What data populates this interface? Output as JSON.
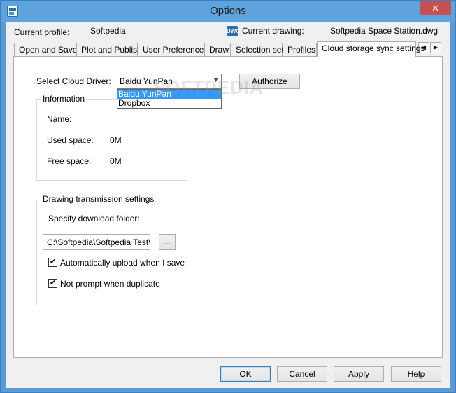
{
  "window": {
    "title": "Options",
    "close_glyph": "✕",
    "app_icon": "app-icon"
  },
  "header": {
    "profile_label": "Current profile:",
    "profile_value": "Softpedia",
    "drawing_label": "Current drawing:",
    "drawing_value": "Softpedia Space Station.dwg",
    "drawing_icon_text": "DWG"
  },
  "tabs": [
    {
      "label": "Open and Save"
    },
    {
      "label": "Plot and Publish"
    },
    {
      "label": "User Preferences"
    },
    {
      "label": "Draw"
    },
    {
      "label": "Selection set"
    },
    {
      "label": "Profiles"
    },
    {
      "label": "Cloud storage sync settings"
    }
  ],
  "tab_scroll": {
    "left": "◀",
    "right": "▶"
  },
  "cloud": {
    "driver_label": "Select Cloud Driver:",
    "driver_selected": "Baidu YunPan",
    "driver_options": [
      "Baidu YunPan",
      "Dropbox"
    ],
    "authorize_button": "Authorize"
  },
  "information": {
    "title": "Information",
    "name_label": "Name:",
    "used_label": "Used space:",
    "used_value": "0M",
    "free_label": "Free space:",
    "free_value": "0M"
  },
  "transmission": {
    "title": "Drawing transmission settings",
    "folder_label": "Specify download folder:",
    "folder_value": "C:\\Softpedia\\Softpedia Test\\A",
    "browse_button": "...",
    "auto_upload_label": "Automatically upload when I save",
    "auto_upload_checked": true,
    "no_prompt_label": "Not prompt when duplicate",
    "no_prompt_checked": true
  },
  "footer": {
    "ok": "OK",
    "cancel": "Cancel",
    "apply": "Apply",
    "help": "Help"
  },
  "watermark": "SOFTPEDIA",
  "colors": {
    "titlebar": "#5fa3de",
    "selection": "#3399ff",
    "close": "#c75050"
  }
}
